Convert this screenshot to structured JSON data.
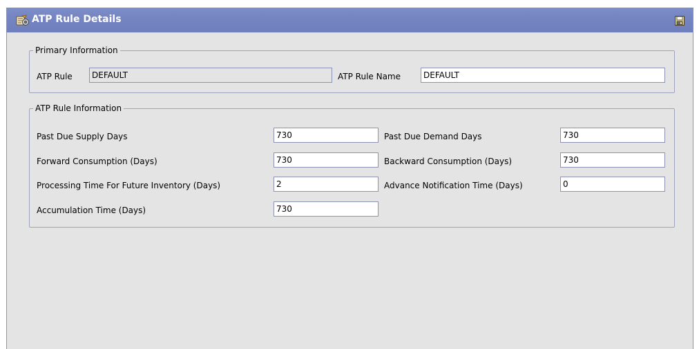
{
  "window": {
    "title": "ATP Rule Details",
    "title_icon": "rule-details-icon",
    "save_icon": "save-icon"
  },
  "primary_information": {
    "legend": "Primary Information",
    "atp_rule_label": "ATP Rule",
    "atp_rule_value": "DEFAULT",
    "atp_rule_name_label": "ATP Rule Name",
    "atp_rule_name_value": "DEFAULT"
  },
  "atp_rule_information": {
    "legend": "ATP Rule Information",
    "past_due_supply_days_label": "Past Due Supply Days",
    "past_due_supply_days_value": "730",
    "past_due_demand_days_label": "Past Due Demand Days",
    "past_due_demand_days_value": "730",
    "forward_consumption_label": "Forward Consumption (Days)",
    "forward_consumption_value": "730",
    "backward_consumption_label": "Backward Consumption (Days)",
    "backward_consumption_value": "730",
    "processing_time_label": "Processing Time For Future Inventory (Days)",
    "processing_time_value": "2",
    "advance_notification_label": "Advance Notification Time (Days)",
    "advance_notification_value": "0",
    "accumulation_time_label": "Accumulation Time (Days)",
    "accumulation_time_value": "730"
  }
}
